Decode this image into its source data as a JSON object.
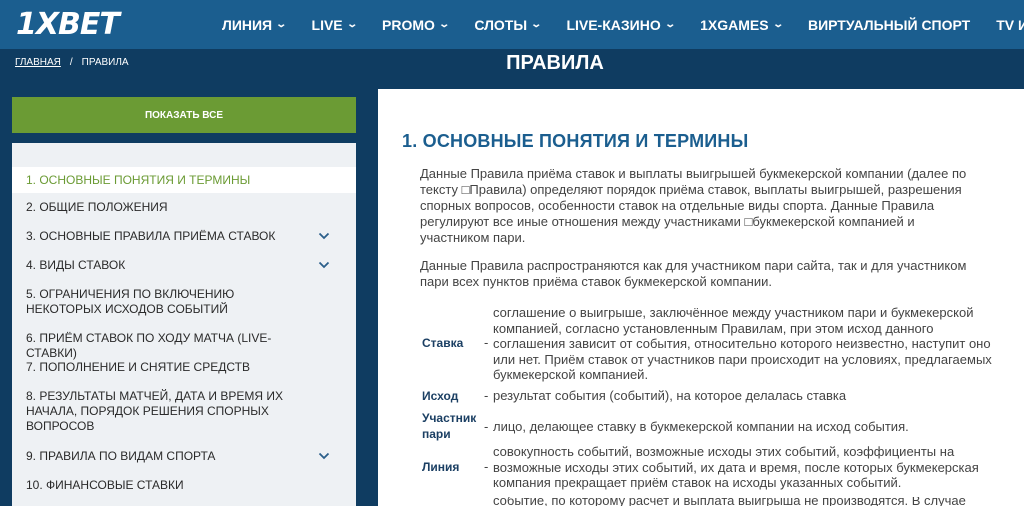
{
  "header": {
    "logo": "1XBET",
    "nav": [
      {
        "label": "ЛИНИЯ",
        "dropdown": true
      },
      {
        "label": "LIVE",
        "dropdown": true
      },
      {
        "label": "PROMO",
        "dropdown": true
      },
      {
        "label": "СЛОТЫ",
        "dropdown": true
      },
      {
        "label": "LIVE-КАЗИНО",
        "dropdown": true
      },
      {
        "label": "1XGAMES",
        "dropdown": true
      },
      {
        "label": "ВИРТУАЛЬНЫЙ СПОРТ",
        "dropdown": false
      },
      {
        "label": "TV ИГРЫ",
        "dropdown": true
      }
    ]
  },
  "breadcrumb": {
    "home": "ГЛАВНАЯ",
    "separator": "/",
    "current": "ПРАВИЛА"
  },
  "page_title": "ПРАВИЛА",
  "sidebar": {
    "show_all": "ПОКАЗАТЬ ВСЕ",
    "items": [
      {
        "label": "1. ОСНОВНЫЕ ПОНЯТИЯ И ТЕРМИНЫ",
        "active": true,
        "expandable": false
      },
      {
        "label": "2. ОБЩИЕ ПОЛОЖЕНИЯ",
        "active": false,
        "expandable": false
      },
      {
        "label": "3. ОСНОВНЫЕ ПРАВИЛА ПРИЁМА СТАВОК",
        "active": false,
        "expandable": true
      },
      {
        "label": "4. ВИДЫ СТАВОК",
        "active": false,
        "expandable": true
      },
      {
        "label": "5. ОГРАНИЧЕНИЯ ПО ВКЛЮЧЕНИЮ НЕКОТОРЫХ ИСХОДОВ СОБЫТИЙ",
        "active": false,
        "expandable": false
      },
      {
        "label": "6. ПРИЁМ СТАВОК ПО ХОДУ МАТЧА (LIVE-СТАВКИ)",
        "active": false,
        "expandable": false
      },
      {
        "label": "7. ПОПОЛНЕНИЕ И СНЯТИЕ СРЕДСТВ",
        "active": false,
        "expandable": false
      },
      {
        "label": "8. РЕЗУЛЬТАТЫ МАТЧЕЙ, ДАТА И ВРЕМЯ ИХ НАЧАЛА, ПОРЯДОК РЕШЕНИЯ СПОРНЫХ ВОПРОСОВ",
        "active": false,
        "expandable": false
      },
      {
        "label": "9. ПРАВИЛА ПО ВИДАМ СПОРТА",
        "active": false,
        "expandable": true
      },
      {
        "label": "10. ФИНАНСОВЫЕ СТАВКИ",
        "active": false,
        "expandable": false
      }
    ]
  },
  "content": {
    "heading": "1. ОСНОВНЫЕ ПОНЯТИЯ И ТЕРМИНЫ",
    "paragraph1": "Данные Правила приёма ставок и выплаты выигрышей букмекерской компании (далее по тексту □Правила) определяют порядок приёма ставок, выплаты выигрышей, разрешения спорных вопросов, особенности ставок на отдельные виды спорта. Данные Правила регулируют все иные отношения между участниками □букмекерской компанией и участником пари.",
    "paragraph2": "Данные Правила распространяются как для участником пари сайта, так и для участником пари всех пунктов приёма ставок букмекерской компании.",
    "definitions": [
      {
        "term": "Ставка",
        "dash": "-",
        "desc": "соглашение о выигрыше, заключённое между участником пари и букмекерской компанией, согласно установленным Правилам, при этом исход данного соглашения зависит от события, относительно которого неизвестно, наступит оно или нет. Приём ставок от участников пари происходит на условиях, предлагаемых букмекерской компанией."
      },
      {
        "term": "Исход",
        "dash": "-",
        "desc": "результат события (событий), на которое делалась ставка"
      },
      {
        "term": "Участник пари",
        "dash": "-",
        "desc": "лицо, делающее ставку в букмекерской компании на исход события."
      },
      {
        "term": "Линия",
        "dash": "-",
        "desc": "совокупность событий, возможные исходы этих событий, коэффициенты на возможные исходы этих событий, их дата и время, после которых букмекерская компания прекращает приём ставок на исходы указанных событий."
      },
      {
        "term": "",
        "dash": "",
        "desc": "событие, по которому расчет и выплата выигрыша не производятся. В случае"
      }
    ]
  },
  "colors": {
    "header": "#1b5e8f",
    "page_bg": "#0f3c61",
    "accent_green": "#6b9b34",
    "heading_blue": "#1b5e8f"
  }
}
